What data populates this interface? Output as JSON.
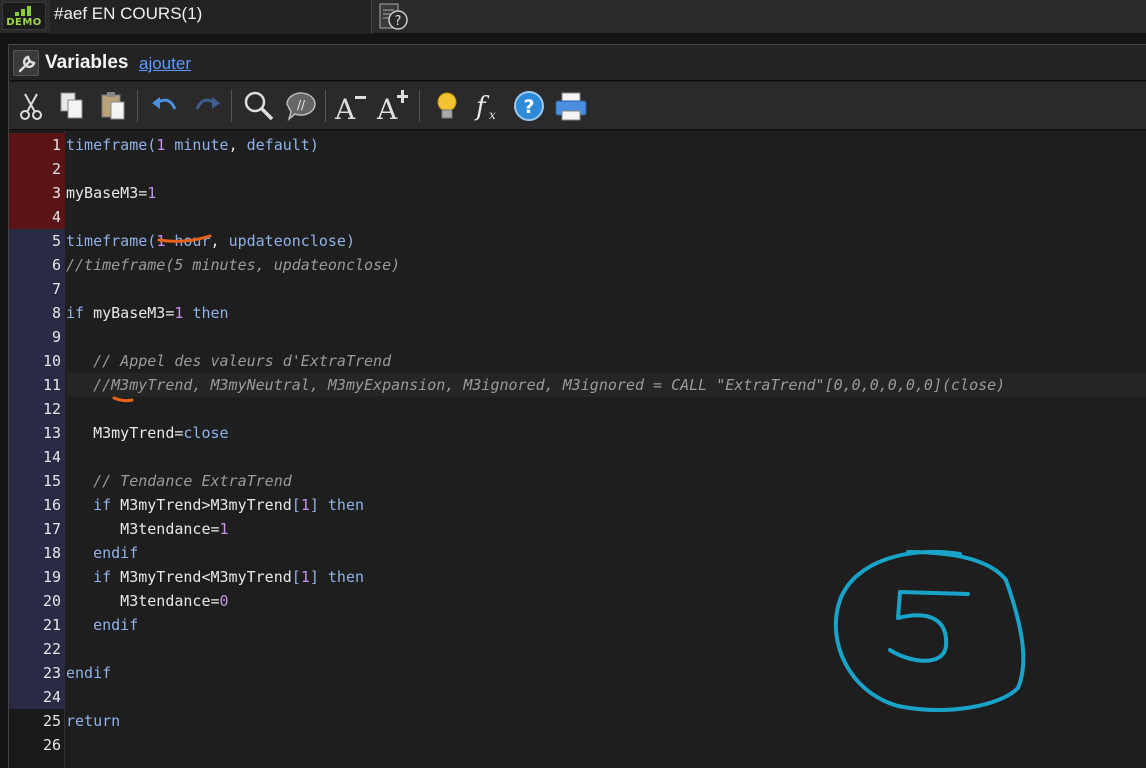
{
  "topbar": {
    "demo_label": "DEMO",
    "doc_tab_title": "#aef EN COURS(1)"
  },
  "panel": {
    "title": "Variables",
    "add_link": "ajouter"
  },
  "toolbar": {
    "buttons": [
      "cut-icon",
      "copy-icon",
      "paste-icon",
      "undo-icon",
      "redo-icon",
      "search-icon",
      "comment-icon",
      "font-decrease-icon",
      "font-increase-icon",
      "lightbulb-icon",
      "function-icon",
      "help-icon",
      "print-icon"
    ]
  },
  "editor": {
    "lines": [
      {
        "n": "1",
        "marker": "red",
        "text": "timeframe(1 minute, default)"
      },
      {
        "n": "2",
        "marker": "red",
        "text": ""
      },
      {
        "n": "3",
        "marker": "red",
        "text": "myBaseM3=1"
      },
      {
        "n": "4",
        "marker": "red",
        "text": ""
      },
      {
        "n": "5",
        "marker": "blue",
        "text": "timeframe(1 hour, updateonclose)"
      },
      {
        "n": "6",
        "marker": "blue",
        "text": "//timeframe(5 minutes, updateonclose)"
      },
      {
        "n": "7",
        "marker": "blue",
        "text": ""
      },
      {
        "n": "8",
        "marker": "blue",
        "text": "if myBaseM3=1 then"
      },
      {
        "n": "9",
        "marker": "blue",
        "text": ""
      },
      {
        "n": "10",
        "marker": "blue",
        "text": "   // Appel des valeurs d'ExtraTrend"
      },
      {
        "n": "11",
        "marker": "blue",
        "text": "   //M3myTrend, M3myNeutral, M3myExpansion, M3ignored, M3ignored = CALL \"ExtraTrend\"[0,0,0,0,0,0](close)"
      },
      {
        "n": "12",
        "marker": "blue",
        "text": ""
      },
      {
        "n": "13",
        "marker": "blue",
        "text": "   M3myTrend=close"
      },
      {
        "n": "14",
        "marker": "blue",
        "text": ""
      },
      {
        "n": "15",
        "marker": "blue",
        "text": "   // Tendance ExtraTrend"
      },
      {
        "n": "16",
        "marker": "blue",
        "text": "   if M3myTrend>M3myTrend[1] then"
      },
      {
        "n": "17",
        "marker": "blue",
        "text": "      M3tendance=1"
      },
      {
        "n": "18",
        "marker": "blue",
        "text": "   endif"
      },
      {
        "n": "19",
        "marker": "blue",
        "text": "   if M3myTrend<M3myTrend[1] then"
      },
      {
        "n": "20",
        "marker": "blue",
        "text": "      M3tendance=0"
      },
      {
        "n": "21",
        "marker": "blue",
        "text": "   endif"
      },
      {
        "n": "22",
        "marker": "blue",
        "text": ""
      },
      {
        "n": "23",
        "marker": "blue",
        "text": "endif"
      },
      {
        "n": "24",
        "marker": "blue",
        "text": ""
      },
      {
        "n": "25",
        "marker": "none",
        "text": "return"
      },
      {
        "n": "26",
        "marker": "none",
        "text": ""
      }
    ]
  },
  "colors": {
    "accent": "#5a9bff",
    "keyword": "#8fb3e8",
    "number": "#c792ea",
    "comment": "#9a9a9a",
    "marker_red": "#5a1416",
    "marker_blue": "#2a2a46",
    "annotation_orange": "#e8621a",
    "annotation_cyan": "#1aa3c8"
  }
}
